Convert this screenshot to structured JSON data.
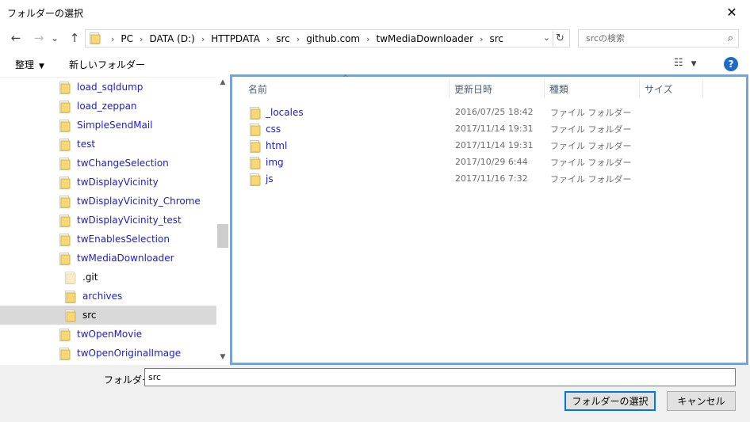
{
  "window": {
    "title": "フォルダーの選択",
    "close_glyph": "✕"
  },
  "nav": {
    "back_glyph": "←",
    "forward_glyph": "→",
    "recent_glyph": "⌄",
    "up_glyph": "↑",
    "breadcrumbs": [
      "PC",
      "DATA (D:)",
      "HTTPDATA",
      "src",
      "github.com",
      "twMediaDownloader",
      "src"
    ],
    "separator": "›",
    "dropdown_glyph": "⌄",
    "refresh_glyph": "↻",
    "search_placeholder": "srcの検索",
    "search_icon": "⌕"
  },
  "toolbar": {
    "organize_label": "整理",
    "organize_caret": "▼",
    "new_folder_label": "新しいフォルダー",
    "view_glyph": "☷",
    "view_caret": "▼",
    "help_glyph": "?"
  },
  "tree": {
    "items": [
      {
        "label": "load_sqldump",
        "indent": 0,
        "selected": false,
        "special": ""
      },
      {
        "label": "load_zeppan",
        "indent": 0,
        "selected": false,
        "special": ""
      },
      {
        "label": "SimpleSendMail",
        "indent": 0,
        "selected": false,
        "special": ""
      },
      {
        "label": "test",
        "indent": 0,
        "selected": false,
        "special": ""
      },
      {
        "label": "twChangeSelection",
        "indent": 0,
        "selected": false,
        "special": ""
      },
      {
        "label": "twDisplayVicinity",
        "indent": 0,
        "selected": false,
        "special": ""
      },
      {
        "label": "twDisplayVicinity_Chrome",
        "indent": 0,
        "selected": false,
        "special": ""
      },
      {
        "label": "twDisplayVicinity_test",
        "indent": 0,
        "selected": false,
        "special": ""
      },
      {
        "label": "twEnablesSelection",
        "indent": 0,
        "selected": false,
        "special": ""
      },
      {
        "label": "twMediaDownloader",
        "indent": 0,
        "selected": false,
        "special": ""
      },
      {
        "label": ".git",
        "indent": 1,
        "selected": false,
        "special": "hidden"
      },
      {
        "label": "archives",
        "indent": 1,
        "selected": false,
        "special": ""
      },
      {
        "label": "src",
        "indent": 1,
        "selected": true,
        "special": ""
      },
      {
        "label": "twOpenMovie",
        "indent": 0,
        "selected": false,
        "special": ""
      },
      {
        "label": "twOpenOriginalImage",
        "indent": 0,
        "selected": false,
        "special": ""
      }
    ],
    "scroll_up": "▲",
    "scroll_down": "▼"
  },
  "files": {
    "sort_glyph": "^",
    "columns": [
      "名前",
      "更新日時",
      "種類",
      "サイズ"
    ],
    "rows": [
      {
        "name": "_locales",
        "date": "2016/07/25 18:42",
        "type": "ファイル フォルダー"
      },
      {
        "name": "css",
        "date": "2017/11/14 19:31",
        "type": "ファイル フォルダー"
      },
      {
        "name": "html",
        "date": "2017/11/14 19:31",
        "type": "ファイル フォルダー"
      },
      {
        "name": "img",
        "date": "2017/10/29 6:44",
        "type": "ファイル フォルダー"
      },
      {
        "name": "js",
        "date": "2017/11/16 7:32",
        "type": "ファイル フォルダー"
      }
    ]
  },
  "footer": {
    "folder_label": "フォルダー:",
    "folder_value": "src",
    "select_button": "フォルダーの選択",
    "cancel_button": "キャンセル"
  },
  "colors": {
    "accent": "#0078d7",
    "link": "#1a1ad9",
    "folder": "#f8d775",
    "pane_border": "#79a2d6"
  }
}
